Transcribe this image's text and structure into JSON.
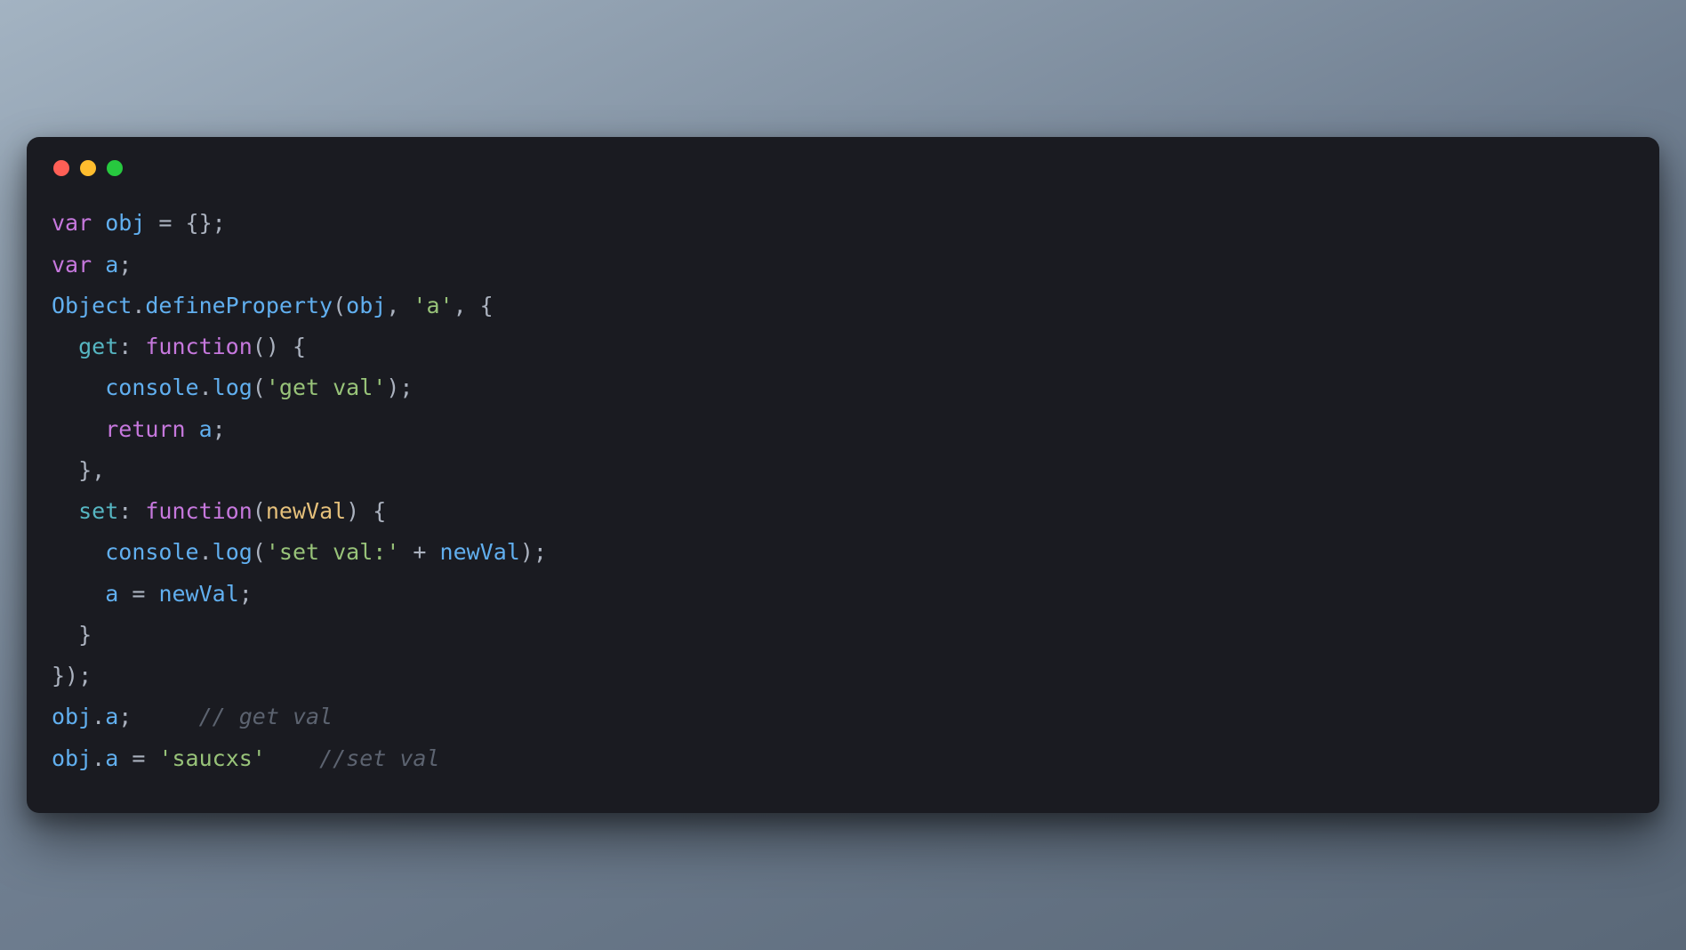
{
  "window": {
    "dots": [
      "red",
      "yellow",
      "green"
    ]
  },
  "code": {
    "tokens": [
      [
        {
          "t": "var",
          "c": "kw"
        },
        {
          "t": " ",
          "c": "pun"
        },
        {
          "t": "obj",
          "c": "name"
        },
        {
          "t": " = {};",
          "c": "pun"
        }
      ],
      [
        {
          "t": "var",
          "c": "kw"
        },
        {
          "t": " ",
          "c": "pun"
        },
        {
          "t": "a",
          "c": "name"
        },
        {
          "t": ";",
          "c": "pun"
        }
      ],
      [
        {
          "t": "Object",
          "c": "name"
        },
        {
          "t": ".",
          "c": "pun"
        },
        {
          "t": "defineProperty",
          "c": "prop"
        },
        {
          "t": "(",
          "c": "pun"
        },
        {
          "t": "obj",
          "c": "name"
        },
        {
          "t": ", ",
          "c": "pun"
        },
        {
          "t": "'a'",
          "c": "str"
        },
        {
          "t": ", {",
          "c": "pun"
        }
      ],
      [
        {
          "t": "  ",
          "c": "pun"
        },
        {
          "t": "get",
          "c": "blue"
        },
        {
          "t": ": ",
          "c": "pun"
        },
        {
          "t": "function",
          "c": "fn"
        },
        {
          "t": "() {",
          "c": "pun"
        }
      ],
      [
        {
          "t": "    ",
          "c": "pun"
        },
        {
          "t": "console",
          "c": "name"
        },
        {
          "t": ".",
          "c": "pun"
        },
        {
          "t": "log",
          "c": "prop"
        },
        {
          "t": "(",
          "c": "pun"
        },
        {
          "t": "'get val'",
          "c": "str"
        },
        {
          "t": ");",
          "c": "pun"
        }
      ],
      [
        {
          "t": "    ",
          "c": "pun"
        },
        {
          "t": "return",
          "c": "kw"
        },
        {
          "t": " ",
          "c": "pun"
        },
        {
          "t": "a",
          "c": "name"
        },
        {
          "t": ";",
          "c": "pun"
        }
      ],
      [
        {
          "t": "  },",
          "c": "pun"
        }
      ],
      [
        {
          "t": "  ",
          "c": "pun"
        },
        {
          "t": "set",
          "c": "blue"
        },
        {
          "t": ": ",
          "c": "pun"
        },
        {
          "t": "function",
          "c": "fn"
        },
        {
          "t": "(",
          "c": "pun"
        },
        {
          "t": "newVal",
          "c": "param"
        },
        {
          "t": ") {",
          "c": "pun"
        }
      ],
      [
        {
          "t": "    ",
          "c": "pun"
        },
        {
          "t": "console",
          "c": "name"
        },
        {
          "t": ".",
          "c": "pun"
        },
        {
          "t": "log",
          "c": "prop"
        },
        {
          "t": "(",
          "c": "pun"
        },
        {
          "t": "'set val:'",
          "c": "str"
        },
        {
          "t": " + ",
          "c": "pun"
        },
        {
          "t": "newVal",
          "c": "name"
        },
        {
          "t": ");",
          "c": "pun"
        }
      ],
      [
        {
          "t": "    ",
          "c": "pun"
        },
        {
          "t": "a",
          "c": "name"
        },
        {
          "t": " = ",
          "c": "pun"
        },
        {
          "t": "newVal",
          "c": "name"
        },
        {
          "t": ";",
          "c": "pun"
        }
      ],
      [
        {
          "t": "  }",
          "c": "pun"
        }
      ],
      [
        {
          "t": "});",
          "c": "pun"
        }
      ],
      [
        {
          "t": "obj",
          "c": "name"
        },
        {
          "t": ".",
          "c": "pun"
        },
        {
          "t": "a",
          "c": "name"
        },
        {
          "t": ";     ",
          "c": "pun"
        },
        {
          "t": "// get val",
          "c": "cm"
        }
      ],
      [
        {
          "t": "obj",
          "c": "name"
        },
        {
          "t": ".",
          "c": "pun"
        },
        {
          "t": "a",
          "c": "name"
        },
        {
          "t": " = ",
          "c": "pun"
        },
        {
          "t": "'saucxs'",
          "c": "str"
        },
        {
          "t": "    ",
          "c": "pun"
        },
        {
          "t": "//set val",
          "c": "cm"
        }
      ]
    ],
    "plain": "var obj = {};\nvar a;\nObject.defineProperty(obj, 'a', {\n  get: function() {\n    console.log('get val');\n    return a;\n  },\n  set: function(newVal) {\n    console.log('set val:' + newVal);\n    a = newVal;\n  }\n});\nobj.a;     // get val\nobj.a = 'saucxs'    //set val"
  }
}
